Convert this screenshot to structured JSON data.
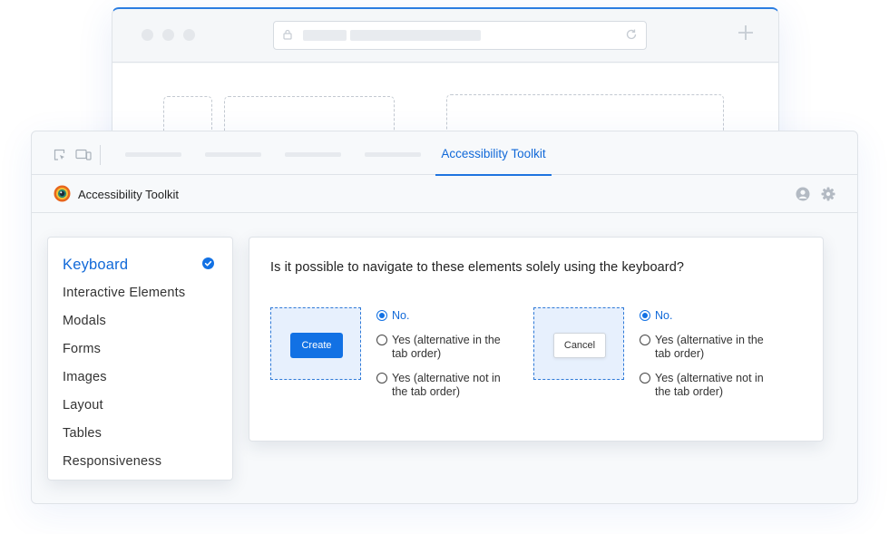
{
  "devtools": {
    "active_tab": "Accessibility Toolkit",
    "header_title": "Accessibility Toolkit"
  },
  "sidebar": {
    "items": [
      {
        "label": "Keyboard",
        "active": true,
        "completed": true
      },
      {
        "label": "Interactive Elements"
      },
      {
        "label": "Modals"
      },
      {
        "label": "Forms"
      },
      {
        "label": "Images"
      },
      {
        "label": "Layout"
      },
      {
        "label": "Tables"
      },
      {
        "label": "Responsiveness"
      }
    ]
  },
  "main": {
    "question": "Is it possible to navigate to these elements solely using the keyboard?",
    "groups": [
      {
        "button_label": "Create",
        "options": [
          {
            "label": "No.",
            "checked": true
          },
          {
            "label": "Yes (alternative in the tab order)"
          },
          {
            "label": "Yes (alternative not in the tab order)"
          }
        ]
      },
      {
        "button_label": "Cancel",
        "options": [
          {
            "label": "No.",
            "checked": true
          },
          {
            "label": "Yes (alternative in the tab order)"
          },
          {
            "label": "Yes (alternative not in the tab order)"
          }
        ]
      }
    ]
  },
  "colors": {
    "accent": "#1271e4",
    "border": "#dfe3e8",
    "panel_bg": "#f7f9fb"
  },
  "icons": [
    "lock-icon",
    "reload-icon",
    "new-tab-icon",
    "inspect-icon",
    "device-icon",
    "logo-icon",
    "user-icon",
    "gear-icon",
    "check-circle-icon"
  ]
}
